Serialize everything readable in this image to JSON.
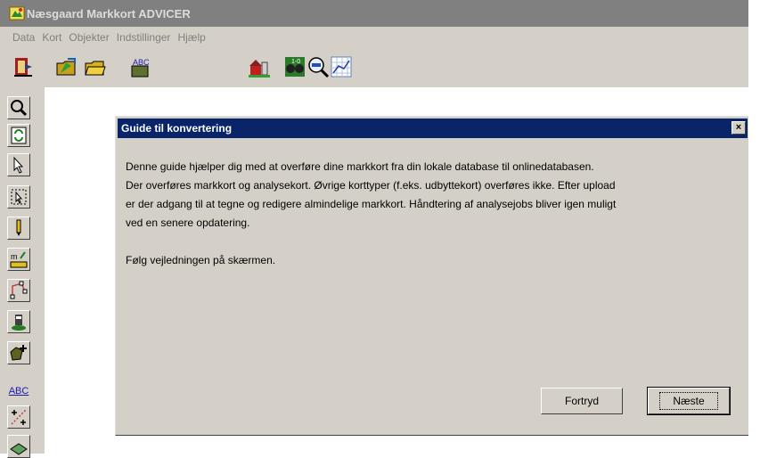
{
  "app": {
    "title": "Næsgaard Markkort ADVICER"
  },
  "menu": [
    "Data",
    "Kort",
    "Objekter",
    "Indstillinger",
    "Hjælp"
  ],
  "toolbar": {
    "icons": [
      "exit-icon",
      "open-folder-icon",
      "folder-icon",
      "spellcheck-icon",
      "farm-icon",
      "binoculars-icon",
      "zoom-adr-icon",
      "grid-chart-icon"
    ],
    "spell_label": "ABC",
    "binocular_label": "1-0"
  },
  "left_tools": {
    "abc_label": "ABC",
    "measure_label": "m"
  },
  "dialog": {
    "title": "Guide til konvertering",
    "close_label": "×",
    "lines": [
      "Denne guide hjælper dig med at overføre dine markkort fra din lokale database til onlinedatabasen.",
      "Der overføres markkort og analysekort. Øvrige korttyper (f.eks. udbyttekort) overføres ikke. Efter upload",
      "er der adgang til at tegne og redigere almindelige markkort. Håndtering af analysejobs bliver igen muligt",
      "ved en senere opdatering."
    ],
    "instruction": "Følg vejledningen på skærmen.",
    "cancel_label": "Fortryd",
    "next_label": "Næste"
  }
}
